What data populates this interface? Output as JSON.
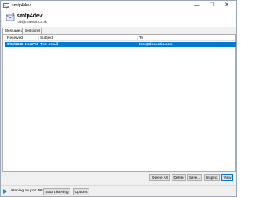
{
  "window": {
    "title": "smtp4dev",
    "controls": {
      "minimize": "—",
      "maximize": "☐",
      "close": "✕"
    },
    "icon": "envelope-icon"
  },
  "header": {
    "app_name": "smtp4dev",
    "email": "rob@rnwood.co.uk",
    "logo_icon": "envelope-logo-icon"
  },
  "tabs": [
    {
      "label": "Messages",
      "active": true
    },
    {
      "label": "Sessions",
      "active": false
    }
  ],
  "table": {
    "columns": [
      "Received",
      "Subject",
      "To"
    ],
    "rows": [
      {
        "received": "9/15/2020 3:54 PM",
        "subject": "Test email",
        "to": "test@docontic.com",
        "selected": true
      }
    ]
  },
  "actions": {
    "delete_all": "Delete All",
    "delete": "Delete",
    "save": "Save...",
    "inspect": "Inspect",
    "view": "View"
  },
  "status": {
    "text": "Listening on port 587",
    "stop_listening": "Stop Listening",
    "options": "Options",
    "play_icon": "play-icon"
  },
  "colors": {
    "accent": "#0078d7",
    "selected_row": "#0078d7",
    "button_bg": "#e1e1e1"
  }
}
